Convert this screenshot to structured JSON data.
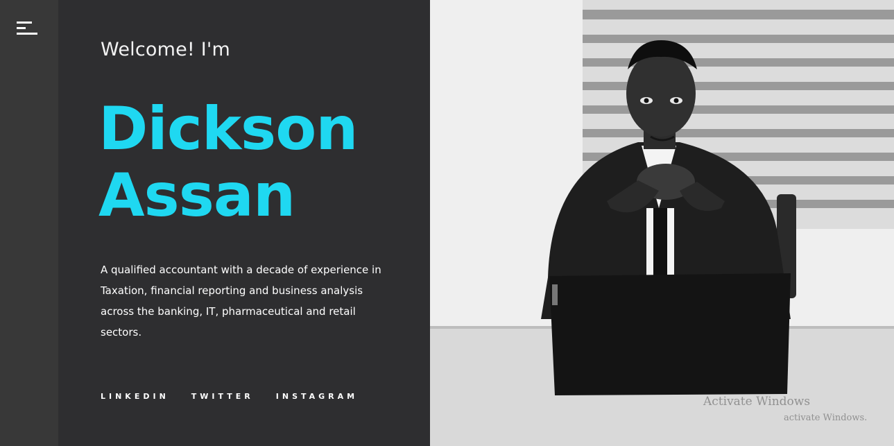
{
  "header": {
    "menu_icon": "hamburger-menu-icon"
  },
  "hero": {
    "welcome": "Welcome! I'm",
    "first_name": "Dickson",
    "last_name": "Assan",
    "bio": "A qualified accountant with a decade of experience in Taxation, financial reporting and business analysis across the banking, IT, pharmaceutical and retail sectors."
  },
  "social": {
    "linkedin": "LINKEDIN",
    "twitter": "TWITTER",
    "instagram": "INSTAGRAM"
  },
  "os_watermark": {
    "title": "Activate Windows",
    "subtitle": "activate Windows."
  },
  "colors": {
    "accent": "#1fd8f1",
    "sidebar": "#383838",
    "content_bg": "#2e2e30",
    "text": "#ffffff"
  }
}
